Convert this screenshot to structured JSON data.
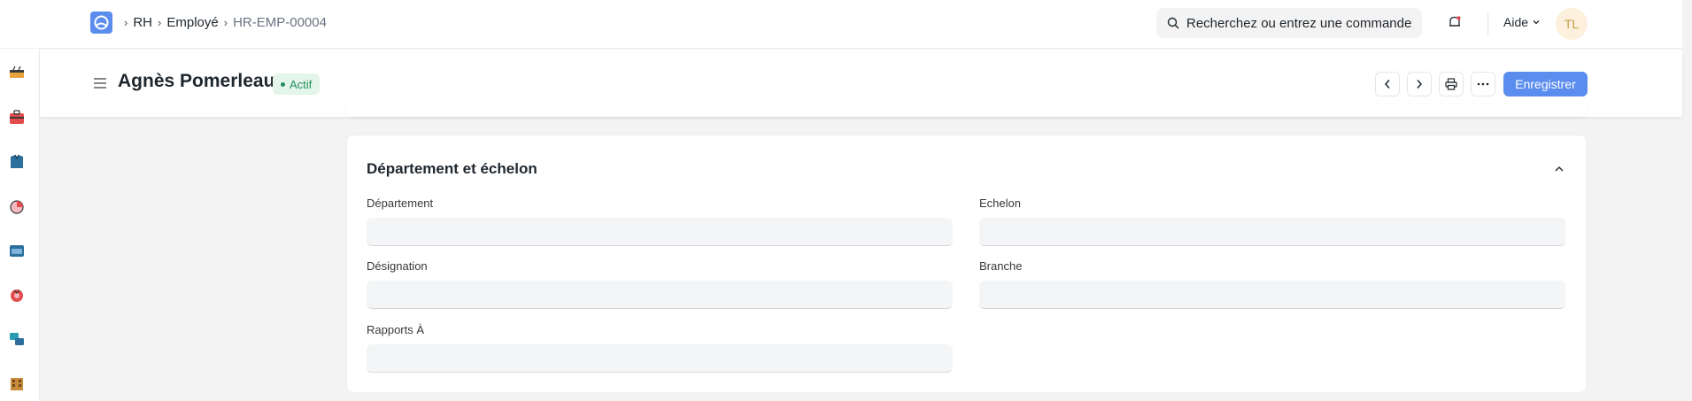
{
  "navbar": {
    "breadcrumbs": [
      "RH",
      "Employé",
      "HR-EMP-00004"
    ],
    "search_placeholder": "Recherchez ou entrez une commande",
    "help_label": "Aide",
    "avatar_initials": "TL"
  },
  "sidebar": {
    "icons": [
      "lunch-box-icon",
      "briefcase-icon",
      "shirt-icon",
      "pie-chart-icon",
      "folder-icon",
      "gift-icon",
      "stack-icon",
      "building-icon"
    ]
  },
  "page_head": {
    "title": "Agnès Pomerleau",
    "status": "Actif",
    "save_label": "Enregistrer"
  },
  "section": {
    "title": "Département et échelon",
    "fields": {
      "department": {
        "label": "Département",
        "value": ""
      },
      "grade": {
        "label": "Echelon",
        "value": ""
      },
      "designation": {
        "label": "Désignation",
        "value": ""
      },
      "branch": {
        "label": "Branche",
        "value": ""
      },
      "reports_to": {
        "label": "Rapports À",
        "value": ""
      }
    }
  },
  "colors": {
    "primary": "#5b8def",
    "status_green": "#278f5e",
    "status_bg": "#e4f5e9"
  }
}
